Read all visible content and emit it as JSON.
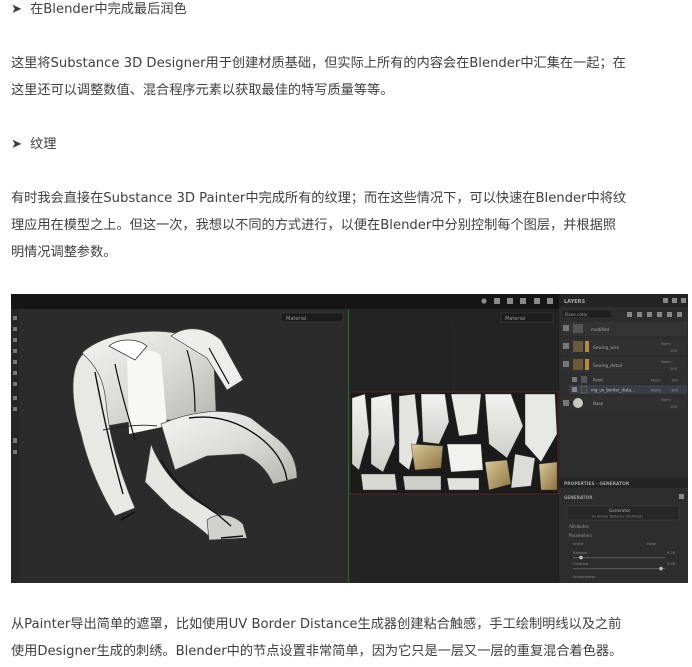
{
  "section1": {
    "arrow": "➤",
    "heading": "在Blender中完成最后润色"
  },
  "paragraph1": {
    "line1": "这里将Substance 3D Designer用于创建材质基础，但实际上所有的内容会在Blender中汇集在一起；在",
    "line2": "这里还可以调整数值、混合程序元素以获取最佳的特写质量等等。"
  },
  "section2": {
    "arrow": "➤",
    "heading": "纹理"
  },
  "paragraph2": {
    "line1": "有时我会直接在Substance 3D Painter中完成所有的纹理；而在这些情况下，可以快速在Blender中将纹",
    "line2": "理应用在模型之上。但这一次，我想以不同的方式进行，以便在Blender中分别控制每个图层，并根据照",
    "line3": "明情况调整参数。"
  },
  "screenshot": {
    "viewport_dropdown": "Material",
    "uv_dropdown": "Material",
    "layers_title": "LAYERS",
    "blend_mode": "Base color",
    "layers": [
      {
        "name": "modified",
        "blend": "",
        "opacity": ""
      },
      {
        "name": "Sewing_wire",
        "blend": "Norm",
        "opacity": "100"
      },
      {
        "name": "Sewing_detail",
        "blend": "Norm",
        "opacity": "100"
      },
      {
        "name": "Paint",
        "blend": "Norm",
        "opacity": "100"
      },
      {
        "name": "mg_uv_border_dista...",
        "blend": "Norm",
        "opacity": "100"
      },
      {
        "name": "Base",
        "blend": "Norm",
        "opacity": "100"
      }
    ],
    "properties_title": "PROPERTIES - GENERATOR",
    "generator_label": "GENERATOR",
    "generator_name": "Generator",
    "generator_sub": "uv Border Distance (Outlined)",
    "attributes_label": "Attributes",
    "parameters_label": "Parameters",
    "param_rows": [
      {
        "label": "Invert",
        "value": "False"
      },
      {
        "label": "Balance",
        "value": "0.28"
      },
      {
        "label": "Contrast",
        "value": "0.96"
      },
      {
        "label": "Smoothness",
        "value": ""
      }
    ]
  },
  "paragraph3": {
    "line1": "从Painter导出简单的遮罩，比如使用UV Border Distance生成器创建粘合触感，手工绘制明线以及之前",
    "line2": "使用Designer生成的刺绣。Blender中的节点设置非常简单，因为它只是一层又一层的重复混合着色器。"
  }
}
